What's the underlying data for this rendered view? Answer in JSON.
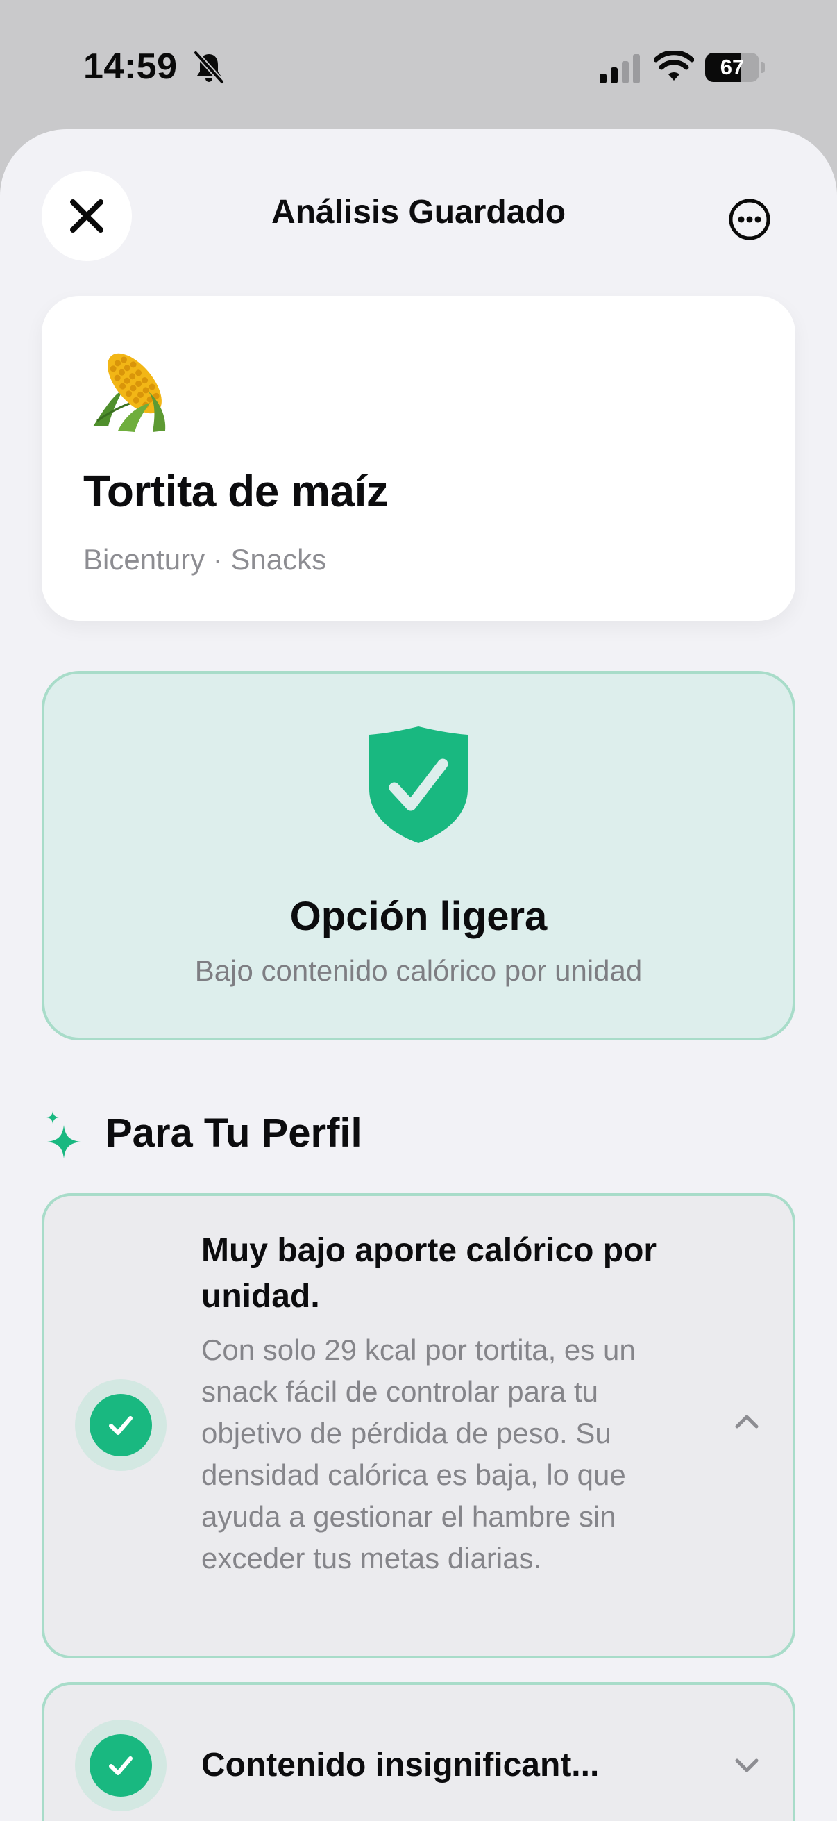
{
  "status_bar": {
    "time": "14:59",
    "battery": "67",
    "battery_level": 0.67,
    "icons": [
      "silent-bell-icon",
      "cellular-signal-icon",
      "wifi-icon",
      "battery-icon"
    ]
  },
  "header": {
    "title": "Análisis Guardado",
    "close_icon": "close-icon",
    "more_icon": "ellipsis-circle-icon"
  },
  "product": {
    "icon": "corn-icon",
    "name": "Tortita de maíz",
    "meta": "Bicentury · Snacks"
  },
  "verdict": {
    "icon": "shield-check-icon",
    "title": "Opción ligera",
    "subtitle": "Bajo contenido calórico por unidad",
    "color": "#19b880"
  },
  "profile_section": {
    "icon": "sparkle-icon",
    "title": "Para Tu Perfil",
    "items": [
      {
        "title": "Muy bajo aporte calórico por unidad.",
        "body": "Con solo 29 kcal por tortita, es un snack fácil de controlar para tu objetivo de pérdida de peso. Su densidad calórica es baja, lo que ayuda a gestionar el hambre sin exceder tus metas diarias.",
        "expanded": true,
        "icon": "check-circle-icon"
      },
      {
        "title": "Contenido insignificant...",
        "body": "",
        "expanded": false,
        "icon": "check-circle-icon"
      }
    ]
  },
  "colors": {
    "accent_green": "#19b880",
    "card_border": "#a8dcc9",
    "sheet_background": "#f2f2f6",
    "status_background": "#c9c9cb"
  }
}
